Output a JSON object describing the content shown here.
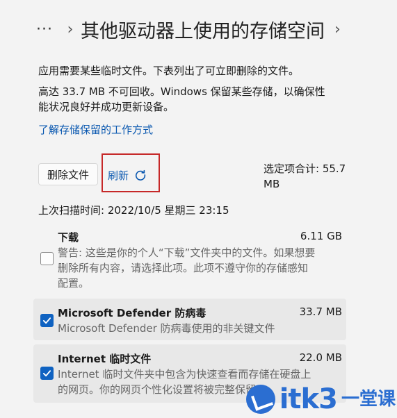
{
  "header": {
    "more_label": "···",
    "separator": "›",
    "title": "其他驱动器上使用的存储空间",
    "next_separator": "›"
  },
  "intro": {
    "line1": "应用需要某些临时文件。下表列出了可立即删除的文件。",
    "line2a": "高达 33.7 MB 不可回收。Windows 保留某些存储，以确保性",
    "line2b": "能状况良好并成功更新设备。",
    "link": "了解存储保留的工作方式"
  },
  "toolbar": {
    "delete_label": "删除文件",
    "refresh_label": "刷新",
    "total_label_a": "选定项合计: 55.7",
    "total_label_b": "MB"
  },
  "scan": {
    "text": "上次扫描时间: 2022/10/5 星期三 23:15"
  },
  "items": [
    {
      "name": "下载",
      "size": "6.11 GB",
      "checked": false,
      "desc1": "警告: 这些是你的个人“下载”文件夹中的文件。如果想要",
      "desc2": "删除所有内容，请选择此项。此项不遵守你的存储感知",
      "desc3": "配置。"
    },
    {
      "name": "Microsoft Defender 防病毒",
      "size": "33.7 MB",
      "checked": true,
      "desc1": "Microsoft Defender 防病毒使用的非关键文件"
    },
    {
      "name": "Internet 临时文件",
      "size": "22.0 MB",
      "checked": true,
      "desc1": "Internet 临时文件夹中包含为快速查看而存储在硬盘上",
      "desc2": "的网页。你的网页个性化设置将被完整保留"
    }
  ],
  "watermark": {
    "brand": "itk3",
    "suffix": "一堂课"
  },
  "colors": {
    "accent": "#0f62c1",
    "link": "#0a58b0",
    "highlight": "#c62828"
  }
}
